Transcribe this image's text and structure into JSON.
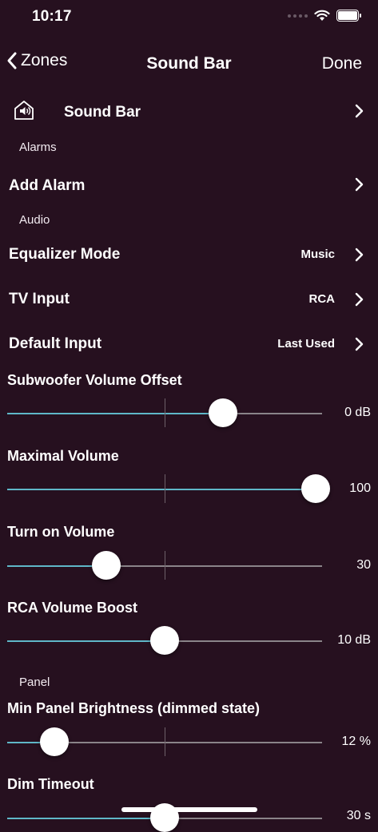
{
  "status_bar": {
    "time": "10:17"
  },
  "nav": {
    "back_label": "Zones",
    "title": "Sound Bar",
    "done_label": "Done"
  },
  "device": {
    "name": "Sound Bar"
  },
  "sections": {
    "alarms": "Alarms",
    "audio": "Audio",
    "panel": "Panel"
  },
  "rows": {
    "add_alarm": "Add Alarm",
    "equalizer": {
      "label": "Equalizer Mode",
      "value": "Music"
    },
    "tv_input": {
      "label": "TV Input",
      "value": "RCA"
    },
    "default_input": {
      "label": "Default Input",
      "value": "Last Used"
    }
  },
  "sliders": {
    "subwoofer": {
      "label": "Subwoofer Volume Offset",
      "value": "0 dB",
      "level": 0.685
    },
    "max_volume": {
      "label": "Maximal Volume",
      "value": "100",
      "level": 0.98
    },
    "turn_on_volume": {
      "label": "Turn on Volume",
      "value": "30",
      "level": 0.315
    },
    "rca_boost": {
      "label": "RCA Volume Boost",
      "value": "10 dB",
      "level": 0.5
    },
    "min_brightness": {
      "label": "Min Panel Brightness (dimmed state)",
      "value": "12 %",
      "level": 0.15
    },
    "dim_timeout": {
      "label": "Dim Timeout",
      "value": "30 s",
      "level": 0.5
    }
  },
  "colors": {
    "background": "#26101f",
    "accent": "#5fb7c8",
    "track": "#8a8489"
  },
  "icons": {
    "back": "chevron-left-icon",
    "disclosure": "chevron-right-icon",
    "device": "house-speaker-icon"
  }
}
